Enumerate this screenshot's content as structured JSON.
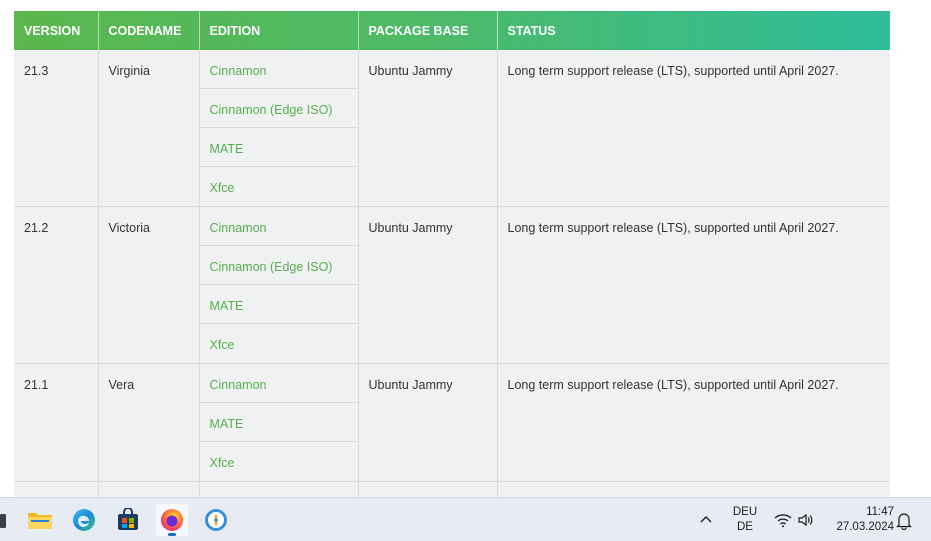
{
  "table": {
    "headers": [
      "VERSION",
      "CODENAME",
      "EDITION",
      "PACKAGE BASE",
      "STATUS"
    ],
    "rows": [
      {
        "version": "21.3",
        "codename": "Virginia",
        "editions": [
          "Cinnamon",
          "Cinnamon (Edge ISO)",
          "MATE",
          "Xfce"
        ],
        "package_base": "Ubuntu Jammy",
        "status": "Long term support release (LTS), supported until April 2027."
      },
      {
        "version": "21.2",
        "codename": "Victoria",
        "editions": [
          "Cinnamon",
          "Cinnamon (Edge ISO)",
          "MATE",
          "Xfce"
        ],
        "package_base": "Ubuntu Jammy",
        "status": "Long term support release (LTS), supported until April 2027."
      },
      {
        "version": "21.1",
        "codename": "Vera",
        "editions": [
          "Cinnamon",
          "MATE",
          "Xfce"
        ],
        "package_base": "Ubuntu Jammy",
        "status": "Long term support release (LTS), supported until April 2027."
      }
    ]
  },
  "taskbar": {
    "apps": [
      {
        "name": "file-explorer-icon"
      },
      {
        "name": "edge-browser-icon"
      },
      {
        "name": "store-icon"
      },
      {
        "name": "firefox-icon",
        "active": true
      },
      {
        "name": "app-compass-icon"
      }
    ],
    "language_line1": "DEU",
    "language_line2": "DE",
    "time": "11:47",
    "date": "27.03.2024"
  },
  "colors": {
    "header_start": "#5bb74d",
    "header_end": "#2fbd9b",
    "link_green": "#56b04d",
    "row_bg": "#f0f1f2"
  }
}
